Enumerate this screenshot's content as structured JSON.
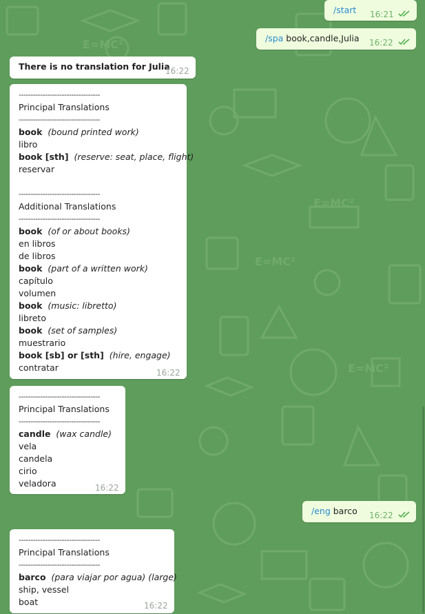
{
  "colors": {
    "wallpaper": "#5f9d5c",
    "outgoing": "#effdde",
    "incoming": "#ffffff",
    "command_link": "#2a8ad1",
    "read_check": "#4fae4e"
  },
  "messages": [
    {
      "dir": "out",
      "command": "/start",
      "text": "",
      "time": "16:21",
      "status": "read"
    },
    {
      "dir": "out",
      "command": "/spa",
      "text": " book,candle,Julia",
      "time": "16:22",
      "status": "read"
    },
    {
      "dir": "in",
      "bold_line": "There is no translation for Julia",
      "time": "16:22"
    },
    {
      "dir": "in",
      "time": "16:22",
      "rows": [
        "----------------------------------",
        "Principal Translations",
        "----------------------------------",
        {
          "term": "book",
          "note": "(bound printed work)"
        },
        "libro",
        {
          "term": "book [sth]",
          "note": "(reserve: seat, place, flight)"
        },
        "reservar",
        "",
        "----------------------------------",
        "Additional Translations",
        "----------------------------------",
        {
          "term": "book",
          "note": "(of or about books)"
        },
        "en libros",
        "de libros",
        {
          "term": "book",
          "note": "(part of a written work)"
        },
        "capítulo",
        "volumen",
        {
          "term": "book",
          "note": "(music: libretto)"
        },
        "libreto",
        {
          "term": "book",
          "note": "(set of samples)"
        },
        "muestrario",
        {
          "term": "book [sb] or [sth]",
          "note": "(hire, engage)"
        },
        "contratar"
      ]
    },
    {
      "dir": "in",
      "time": "16:22",
      "rows": [
        "----------------------------------",
        "Principal Translations",
        "----------------------------------",
        {
          "term": "candle",
          "note": "(wax candle)"
        },
        "vela",
        "candela",
        "cirio",
        "veladora"
      ]
    },
    {
      "dir": "out",
      "command": "/eng",
      "text": " barco",
      "time": "16:22",
      "status": "read"
    },
    {
      "dir": "in",
      "time": "16:22",
      "rows": [
        "----------------------------------",
        "Principal Translations",
        "----------------------------------",
        {
          "term": "barco",
          "note": "(para viajar por agua) (large)"
        },
        "ship, vessel",
        "boat"
      ]
    }
  ]
}
